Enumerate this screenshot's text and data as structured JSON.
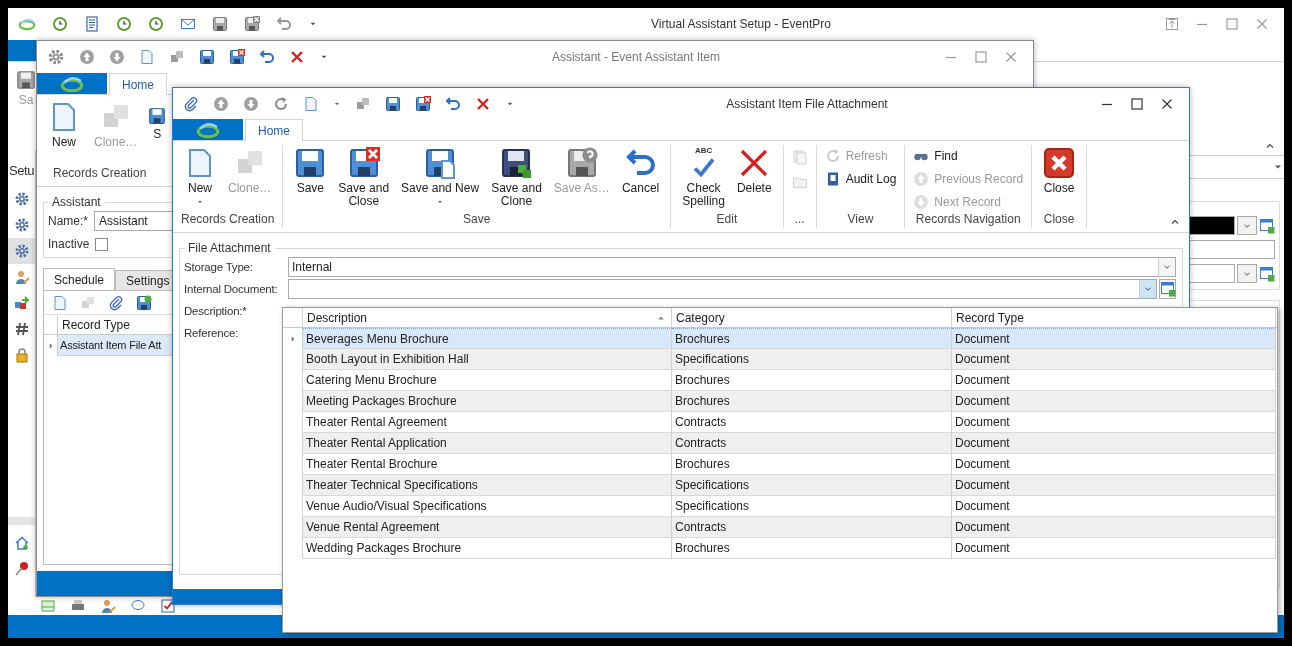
{
  "main_window": {
    "title": "Virtual Assistant Setup - EventPro",
    "ribbon_button": "Sa",
    "sidebar_title": "Setu",
    "sidebar_items": [
      {
        "selected": false
      },
      {
        "selected": false
      },
      {
        "selected": true
      },
      {
        "selected": false
      },
      {
        "selected": false
      },
      {
        "selected": false
      },
      {
        "selected": false
      }
    ]
  },
  "assistant_window": {
    "title": "Assistant - Event Assistant Item",
    "tabs": [
      {
        "label": "Home",
        "selected": true
      }
    ],
    "ribbon_buttons": [
      {
        "label": "New",
        "disabled": false
      },
      {
        "label": "Clone…",
        "disabled": true
      },
      {
        "label": "S",
        "disabled": false
      }
    ],
    "ribbon_group": "Records Creation",
    "group_box": "Assistant",
    "name_label": "Name:*",
    "name_value": "Assistant",
    "inactive_label": "Inactive",
    "inactive_checked": false,
    "detail_tabs": [
      {
        "label": "Schedule",
        "selected": true
      },
      {
        "label": "Settings",
        "selected": false
      }
    ],
    "grid_column": "Record Type",
    "grid_rows": [
      {
        "text": "Assistant Item File Att",
        "selected": true
      }
    ]
  },
  "attachment_window": {
    "title": "Assistant Item File Attachment",
    "tabs": [
      {
        "label": "Home",
        "selected": true
      }
    ],
    "ribbon_groups": [
      {
        "label": "Records Creation",
        "buttons": [
          {
            "kind": "large",
            "label": "New",
            "dropdown": true,
            "disabled": false
          },
          {
            "kind": "large",
            "label": "Clone…",
            "dropdown": false,
            "disabled": true
          }
        ]
      },
      {
        "label": "Save",
        "buttons": [
          {
            "kind": "large",
            "label": "Save",
            "dropdown": false,
            "disabled": false
          },
          {
            "kind": "large",
            "label": "Save and\nClose",
            "dropdown": false,
            "disabled": false
          },
          {
            "kind": "large",
            "label": "Save and New",
            "dropdown": true,
            "disabled": false
          },
          {
            "kind": "large",
            "label": "Save and\nClone",
            "dropdown": false,
            "disabled": false
          },
          {
            "kind": "large",
            "label": "Save As…",
            "dropdown": false,
            "disabled": true
          },
          {
            "kind": "large",
            "label": "Cancel",
            "dropdown": false,
            "disabled": false
          }
        ]
      },
      {
        "label": "Edit",
        "buttons": [
          {
            "kind": "large",
            "label": "Check\nSpelling",
            "badge": "ABC",
            "dropdown": false,
            "disabled": false
          },
          {
            "kind": "large",
            "label": "Delete",
            "dropdown": false,
            "disabled": false
          }
        ]
      },
      {
        "label": "...",
        "buttons": [
          {
            "kind": "icon",
            "disabled": true
          },
          {
            "kind": "icon",
            "disabled": true
          }
        ]
      },
      {
        "label": "View",
        "buttons": [
          {
            "kind": "small",
            "label": "Refresh",
            "disabled": true
          },
          {
            "kind": "small",
            "label": "Audit Log",
            "disabled": false
          }
        ]
      },
      {
        "label": "Records Navigation",
        "buttons": [
          {
            "kind": "small",
            "label": "Find",
            "disabled": false
          },
          {
            "kind": "small",
            "label": "Previous Record",
            "disabled": true
          },
          {
            "kind": "small",
            "label": "Next Record",
            "disabled": true
          }
        ]
      },
      {
        "label": "Close",
        "buttons": [
          {
            "kind": "large",
            "label": "Close",
            "dropdown": false,
            "disabled": false
          }
        ]
      }
    ],
    "form": {
      "legend": "File Attachment",
      "fields": [
        {
          "label": "Storage Type:",
          "kind": "combo",
          "value": "Internal"
        },
        {
          "label": "Internal Document:",
          "kind": "lookup"
        },
        {
          "label": "Description:*",
          "kind": "covered"
        },
        {
          "label": "Reference:",
          "kind": "covered"
        }
      ]
    },
    "document_list": {
      "columns": [
        {
          "label": "Description",
          "sorted": true
        },
        {
          "label": "Category",
          "sorted": false
        },
        {
          "label": "Record Type",
          "sorted": false
        }
      ],
      "rows": [
        {
          "cells": [
            "Beverages Menu Brochure",
            "Brochures",
            "Document"
          ],
          "selected": true
        },
        {
          "cells": [
            "Booth Layout in Exhibition Hall",
            "Specifications",
            "Document"
          ],
          "selected": false
        },
        {
          "cells": [
            "Catering Menu Brochure",
            "Brochures",
            "Document"
          ],
          "selected": false
        },
        {
          "cells": [
            "Meeting Packages Brochure",
            "Brochures",
            "Document"
          ],
          "selected": false
        },
        {
          "cells": [
            "Theater Rental Agreement",
            "Contracts",
            "Document"
          ],
          "selected": false
        },
        {
          "cells": [
            "Theater Rental Application",
            "Contracts",
            "Document"
          ],
          "selected": false
        },
        {
          "cells": [
            "Theater Rental Brochure",
            "Brochures",
            "Document"
          ],
          "selected": false
        },
        {
          "cells": [
            "Theater Technical Specifications",
            "Specifications",
            "Document"
          ],
          "selected": false
        },
        {
          "cells": [
            "Venue Audio/Visual Specifications",
            "Specifications",
            "Document"
          ],
          "selected": false
        },
        {
          "cells": [
            "Venue Rental Agreement",
            "Contracts",
            "Document"
          ],
          "selected": false
        },
        {
          "cells": [
            "Wedding Packages Brochure",
            "Brochures",
            "Document"
          ],
          "selected": false
        }
      ]
    }
  }
}
